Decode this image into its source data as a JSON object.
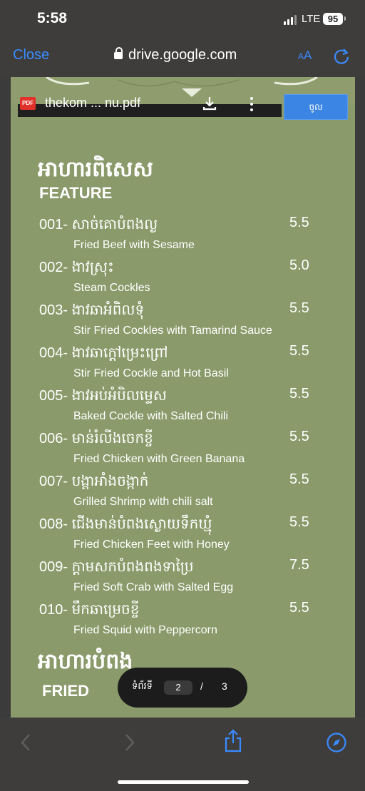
{
  "status": {
    "time": "5:58",
    "network": "LTE",
    "battery": "95"
  },
  "browser": {
    "close_label": "Close",
    "url": "drive.google.com",
    "aa_label": "AA",
    "aa_small": "A"
  },
  "pdf": {
    "badge": "PDF",
    "filename": "thekom ... nu.pdf",
    "open_button": "ចូល"
  },
  "menu": {
    "sections": [
      {
        "title_kh": "អាហារពិសេស",
        "title_en": "FEATURE"
      },
      {
        "title_kh": "អាហារបំពង",
        "title_en": "FRIED"
      }
    ],
    "items": [
      {
        "name": "001- សាច់គោបំពងល្ង",
        "price": "5.5",
        "desc": "Fried Beef with Sesame"
      },
      {
        "name": "002- ងាវស្រុះ",
        "price": "5.0",
        "desc": "Steam Cockles"
      },
      {
        "name": "003- ងាវឆាអំពិលទុំ",
        "price": "5.5",
        "desc": "Stir Fried Cockles with Tamarind Sauce"
      },
      {
        "name": "004- ងាវឆាក្តៅម្រេះព្រៅ",
        "price": "5.5",
        "desc": "Stir Fried Cockle and Hot Basil"
      },
      {
        "name": "005- ងាវអប់អំបិលម្ទេស",
        "price": "5.5",
        "desc": "Baked Cockle with Salted Chili"
      },
      {
        "name": "006- មាន់រំលីងចេកខ្ចី",
        "price": "5.5",
        "desc": "Fried Chicken with Green Banana"
      },
      {
        "name": "007- បង្គាអាំងចង្កាក់",
        "price": "5.5",
        "desc": "Grilled Shrimp with chili salt"
      },
      {
        "name": "008- ជើងមាន់បំពងស្ងោយទឹកឃ្មុំ",
        "price": "5.5",
        "desc": "Fried Chicken Feet with Honey"
      },
      {
        "name": "009- ក្តាមសកបំពងពងទាប្រៃ",
        "price": "7.5",
        "desc": "Fried Soft Crab with Salted Egg"
      },
      {
        "name": "010- មឹកឆាម្រេចខ្ចី",
        "price": "5.5",
        "desc": "Fried Squid with Peppercorn"
      }
    ]
  },
  "pager": {
    "label": "ទំព័រទី",
    "current": "2",
    "separator": "/",
    "total": "3"
  },
  "icons": {
    "lock": "lock-icon",
    "reload": "reload-icon",
    "download": "download-icon",
    "more": "more-icon",
    "back": "back-icon",
    "forward": "forward-icon",
    "share": "share-icon",
    "compass": "compass-icon"
  },
  "colors": {
    "page_bg": "#8a9a6a",
    "accent": "#3a8bff",
    "open_button": "#3b86e4",
    "pdf_badge": "#e0322b"
  }
}
